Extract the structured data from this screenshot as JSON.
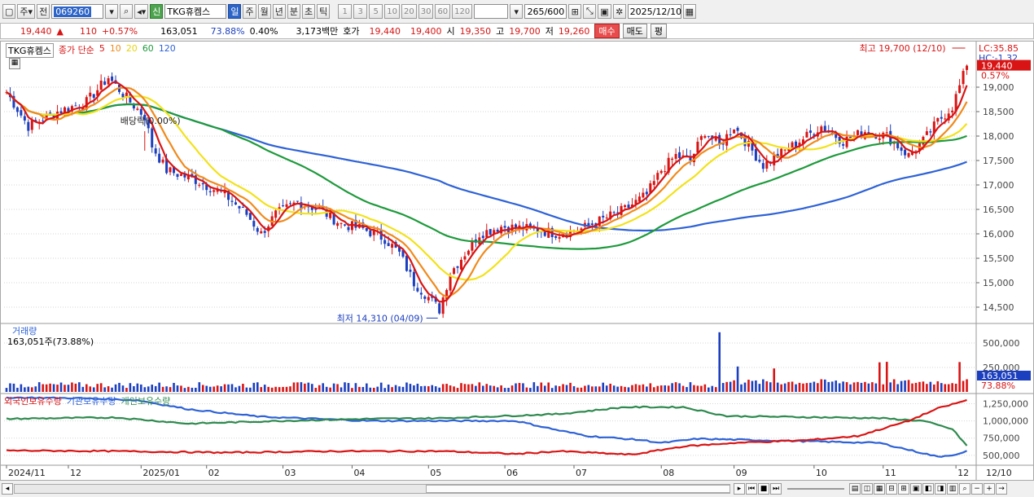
{
  "toolbar": {
    "period_type": "주",
    "market": "전",
    "code": "069260",
    "credit_badge": "신",
    "name": "TKG휴켐스",
    "periods": [
      "일",
      "주",
      "월",
      "년",
      "분",
      "초",
      "틱"
    ],
    "active_period": "일",
    "nums": [
      "1",
      "3",
      "5",
      "10",
      "20",
      "30",
      "60",
      "120"
    ],
    "count": "265",
    "count_total": "/600",
    "date": "2025/12/10"
  },
  "quote": {
    "price": "19,440",
    "change_arrow": "▲",
    "change": "110",
    "change_pct": "+0.57%",
    "volume": "163,051",
    "vol_ratio": "73.88%",
    "turnover": "0.40%",
    "amount": "3,173백만",
    "hoga_label": "호가",
    "ask": "19,440",
    "bid": "19,400",
    "open_label": "시",
    "open": "19,350",
    "high_label": "고",
    "high": "19,700",
    "low_label": "저",
    "low": "19,260",
    "buy_label": "매수",
    "sell_label": "매도",
    "avg_label": "평"
  },
  "price_panel": {
    "legend_name": "TKG휴켐스",
    "ma_label": "종가 단순",
    "ma_periods": [
      "5",
      "10",
      "20",
      "60",
      "120"
    ],
    "lc": "LC:35.85",
    "hc": "HC:-1.32",
    "current": "19,440",
    "current_pct": "0.57%",
    "y_ticks": [
      "19,000",
      "18,500",
      "18,000",
      "17,500",
      "17,000",
      "16,500",
      "16,000",
      "15,500",
      "15,000",
      "14,500"
    ],
    "high_annot": "최고 19,700 (12/10)",
    "low_annot": "최저 14,310 (04/09)",
    "div_annot": "배당락(0.00%)"
  },
  "volume_panel": {
    "title": "거래량",
    "value": "163,051주(73.88%)",
    "y_ticks": [
      "500,000",
      "250,000"
    ],
    "current": "163,051",
    "current_pct": "73.88%"
  },
  "holder_panel": {
    "legend": [
      "외국인보유수량",
      "기관보유수량",
      "개인보유수량"
    ],
    "y_ticks": [
      "1,250,000",
      "1,000,000",
      "750,000",
      "500,000"
    ]
  },
  "x_axis": {
    "labels": [
      "2024/11",
      "12",
      "2025/01",
      "02",
      "03",
      "04",
      "05",
      "06",
      "07",
      "08",
      "09",
      "10",
      "11",
      "12"
    ],
    "right_label": "12/10"
  },
  "colors": {
    "up": "#d91414",
    "down": "#1c3fbf",
    "ma5": "#d91414",
    "ma10": "#f08a1c",
    "ma20": "#f2e21a",
    "ma60": "#1e9a3c",
    "ma120": "#2e62d6",
    "foreign": "#d91414",
    "inst": "#2e62d6",
    "indiv": "#2e8a4e"
  },
  "chart_data": {
    "type": "line",
    "title": "TKG휴켐스",
    "x": [
      "2024/11",
      "12",
      "2025/01",
      "02",
      "03",
      "04",
      "05",
      "06",
      "07",
      "08",
      "09",
      "10",
      "11",
      "12"
    ],
    "ylim": [
      14200,
      19800
    ],
    "series": [
      {
        "name": "종가",
        "values": [
          18900,
          18500,
          18600,
          17200,
          16400,
          16100,
          15100,
          16100,
          16200,
          17500,
          17800,
          17700,
          17800,
          18300,
          19440
        ]
      },
      {
        "name": "120",
        "values": [
          19100,
          19000,
          18900,
          18400,
          17600,
          16900,
          16300,
          16200,
          16100,
          16250,
          16500,
          16800,
          17100,
          17400,
          17750
        ]
      },
      {
        "name": "60",
        "values": [
          19050,
          18900,
          18800,
          17900,
          17000,
          16400,
          16000,
          15900,
          16000,
          16700,
          17400,
          17800,
          17900,
          18000,
          18100
        ]
      }
    ],
    "annotations": {
      "high": 19700,
      "high_date": "12/10",
      "low": 14310,
      "low_date": "04/09"
    }
  }
}
